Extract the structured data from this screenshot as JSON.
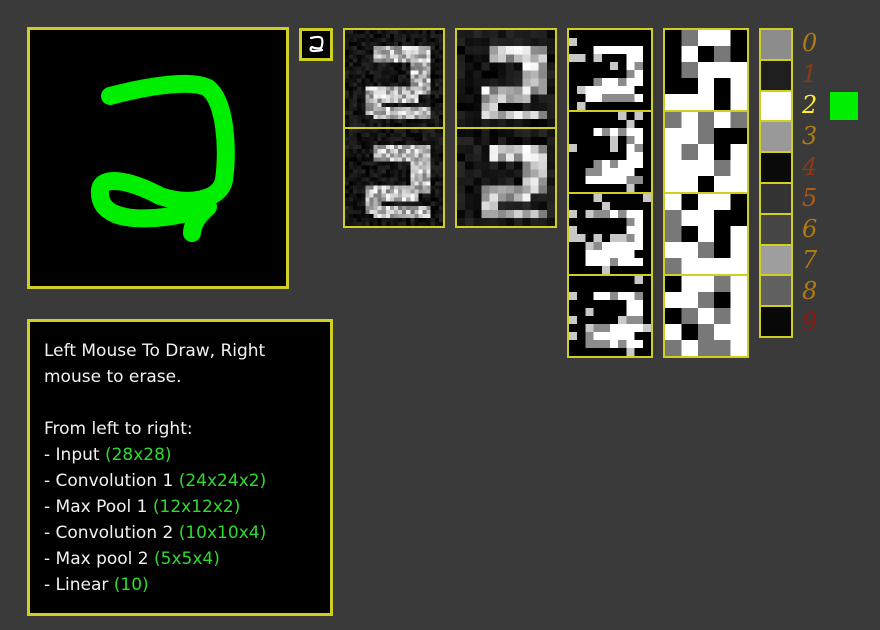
{
  "predicted_digit": "2",
  "colors": {
    "panel_border": "#cfcf22",
    "background": "#3a3a3a",
    "stroke": "#00ee00",
    "dim_text": "#2edb2e",
    "prediction_marker": "#00ee00"
  },
  "instructions": {
    "line1": "Left Mouse To Draw, Right",
    "line2": "mouse to erase.",
    "intro": "From left to right:",
    "layers": [
      {
        "name": "- Input",
        "size": "(28x28)"
      },
      {
        "name": "- Convolution 1",
        "size": "(24x24x2)"
      },
      {
        "name": "- Max Pool 1",
        "size": "(12x12x2)"
      },
      {
        "name": "- Convolution 2",
        "size": "(10x10x4)"
      },
      {
        "name": "- Max pool 2",
        "size": "(5x5x4)"
      },
      {
        "name": "- Linear",
        "size": "(10)"
      }
    ]
  },
  "output": {
    "digits": [
      "0",
      "1",
      "2",
      "3",
      "4",
      "5",
      "6",
      "7",
      "8",
      "9"
    ],
    "digit_colors": [
      "#b07b10",
      "#8c3a12",
      "#ffee33",
      "#b07b10",
      "#8c3a12",
      "#b05a12",
      "#b07b10",
      "#b07b10",
      "#b07b10",
      "#8c1a12"
    ],
    "activations": [
      0.55,
      0.12,
      1.0,
      0.6,
      0.04,
      0.2,
      0.27,
      0.62,
      0.38,
      0.03
    ]
  }
}
